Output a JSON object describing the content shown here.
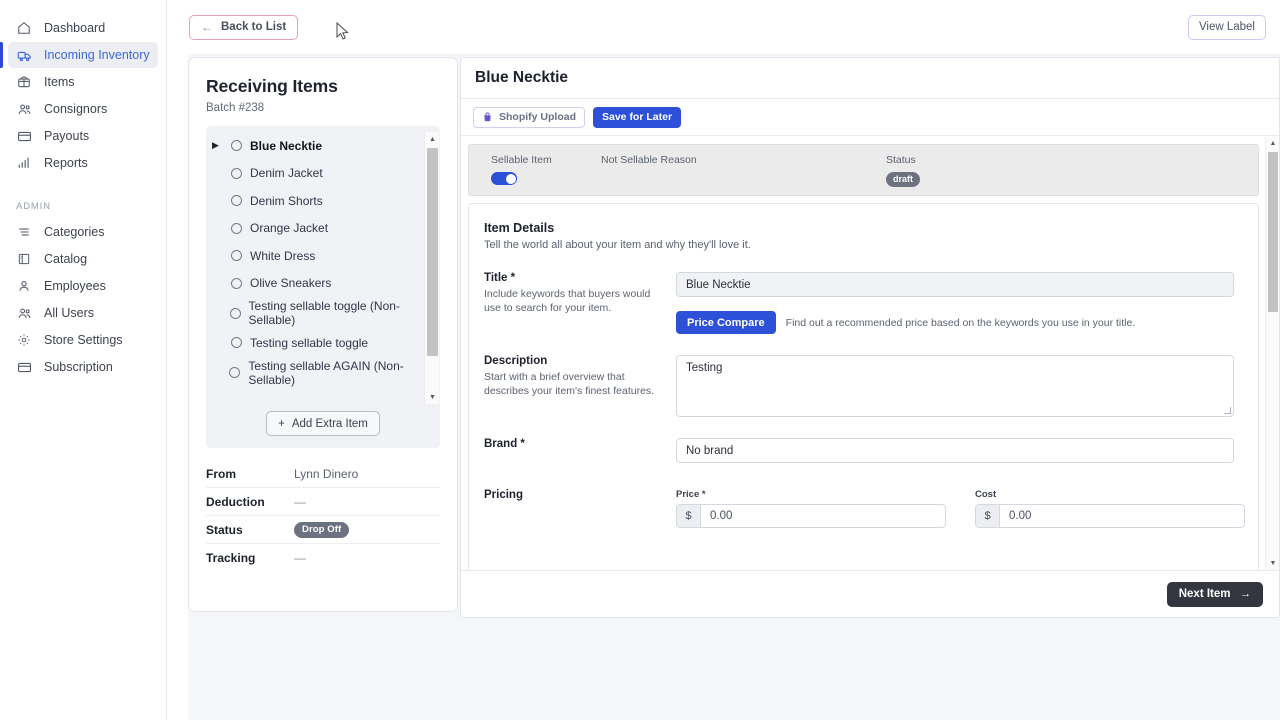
{
  "sidebar": {
    "items": [
      {
        "label": "Dashboard",
        "icon": "home-icon",
        "active": false
      },
      {
        "label": "Incoming Inventory",
        "icon": "truck-icon",
        "active": true
      },
      {
        "label": "Items",
        "icon": "box-icon",
        "active": false
      },
      {
        "label": "Consignors",
        "icon": "users-icon",
        "active": false
      },
      {
        "label": "Payouts",
        "icon": "card-icon",
        "active": false
      },
      {
        "label": "Reports",
        "icon": "bar-chart-icon",
        "active": false
      }
    ],
    "section_label": "ADMIN",
    "admin_items": [
      {
        "label": "Categories",
        "icon": "list-icon",
        "active": false
      },
      {
        "label": "Catalog",
        "icon": "book-icon",
        "active": false
      },
      {
        "label": "Employees",
        "icon": "person-icon",
        "active": false
      },
      {
        "label": "All Users",
        "icon": "users-icon",
        "active": false
      },
      {
        "label": "Store Settings",
        "icon": "gear-icon",
        "active": false
      },
      {
        "label": "Subscription",
        "icon": "card-icon",
        "active": false
      }
    ]
  },
  "topbar": {
    "back_label": "Back to List",
    "back_arrow": "←",
    "view_label": "View Label"
  },
  "receiving": {
    "title": "Receiving Items",
    "batch": "Batch #238",
    "items": [
      {
        "label": "Blue Necktie",
        "selected": true
      },
      {
        "label": "Denim Jacket",
        "selected": false
      },
      {
        "label": "Denim Shorts",
        "selected": false
      },
      {
        "label": "Orange Jacket",
        "selected": false
      },
      {
        "label": "White Dress",
        "selected": false
      },
      {
        "label": "Olive Sneakers",
        "selected": false
      },
      {
        "label": "Testing sellable toggle (Non-Sellable)",
        "selected": false
      },
      {
        "label": "Testing sellable toggle",
        "selected": false
      },
      {
        "label": "Testing sellable AGAIN (Non-Sellable)",
        "selected": false
      }
    ],
    "add_extra_label": "Add Extra Item",
    "add_extra_plus": "+",
    "meta": [
      {
        "key": "From",
        "value": "Lynn Dinero",
        "type": "text"
      },
      {
        "key": "Deduction",
        "value": "—",
        "type": "dash"
      },
      {
        "key": "Status",
        "value": "Drop Off",
        "type": "pill"
      },
      {
        "key": "Tracking",
        "value": "—",
        "type": "dash"
      }
    ]
  },
  "detail": {
    "title": "Blue Necktie",
    "shopify_label": "Shopify Upload",
    "save_later_label": "Save for Later",
    "status_strip": {
      "sellable_label": "Sellable Item",
      "not_sellable_reason_label": "Not Sellable Reason",
      "status_label": "Status",
      "status_value": "draft",
      "sellable_on": true
    },
    "section": {
      "title": "Item Details",
      "subtitle": "Tell the world all about your item and why they'll love it."
    },
    "fields": {
      "title": {
        "label": "Title *",
        "help": "Include keywords that buyers would use to search for your item.",
        "value": "Blue Necktie",
        "placeholder": "Title"
      },
      "price_compare": {
        "button_label": "Price Compare",
        "hint": "Find out a recommended price based on the keywords you use in your title."
      },
      "description": {
        "label": "Description",
        "help": "Start with a brief overview that describes your item's finest features.",
        "value": "Testing",
        "placeholder": "Description"
      },
      "brand": {
        "label": "Brand *",
        "value": "No brand",
        "placeholder": "No brand"
      },
      "pricing": {
        "label": "Pricing",
        "price_label": "Price *",
        "price_prefix": "$",
        "price_value": "0.00",
        "cost_label": "Cost",
        "cost_prefix": "$",
        "cost_value": "0.00"
      }
    },
    "next_label": "Next Item",
    "next_arrow": "→"
  },
  "colors": {
    "accent_blue": "#2c50d8",
    "active_nav_text": "#3f66e0",
    "back_border_pink": "#e89ec1",
    "page_bg": "#f5f6fa",
    "pill_gray": "#6c727f",
    "next_btn_dark": "#33363f"
  }
}
